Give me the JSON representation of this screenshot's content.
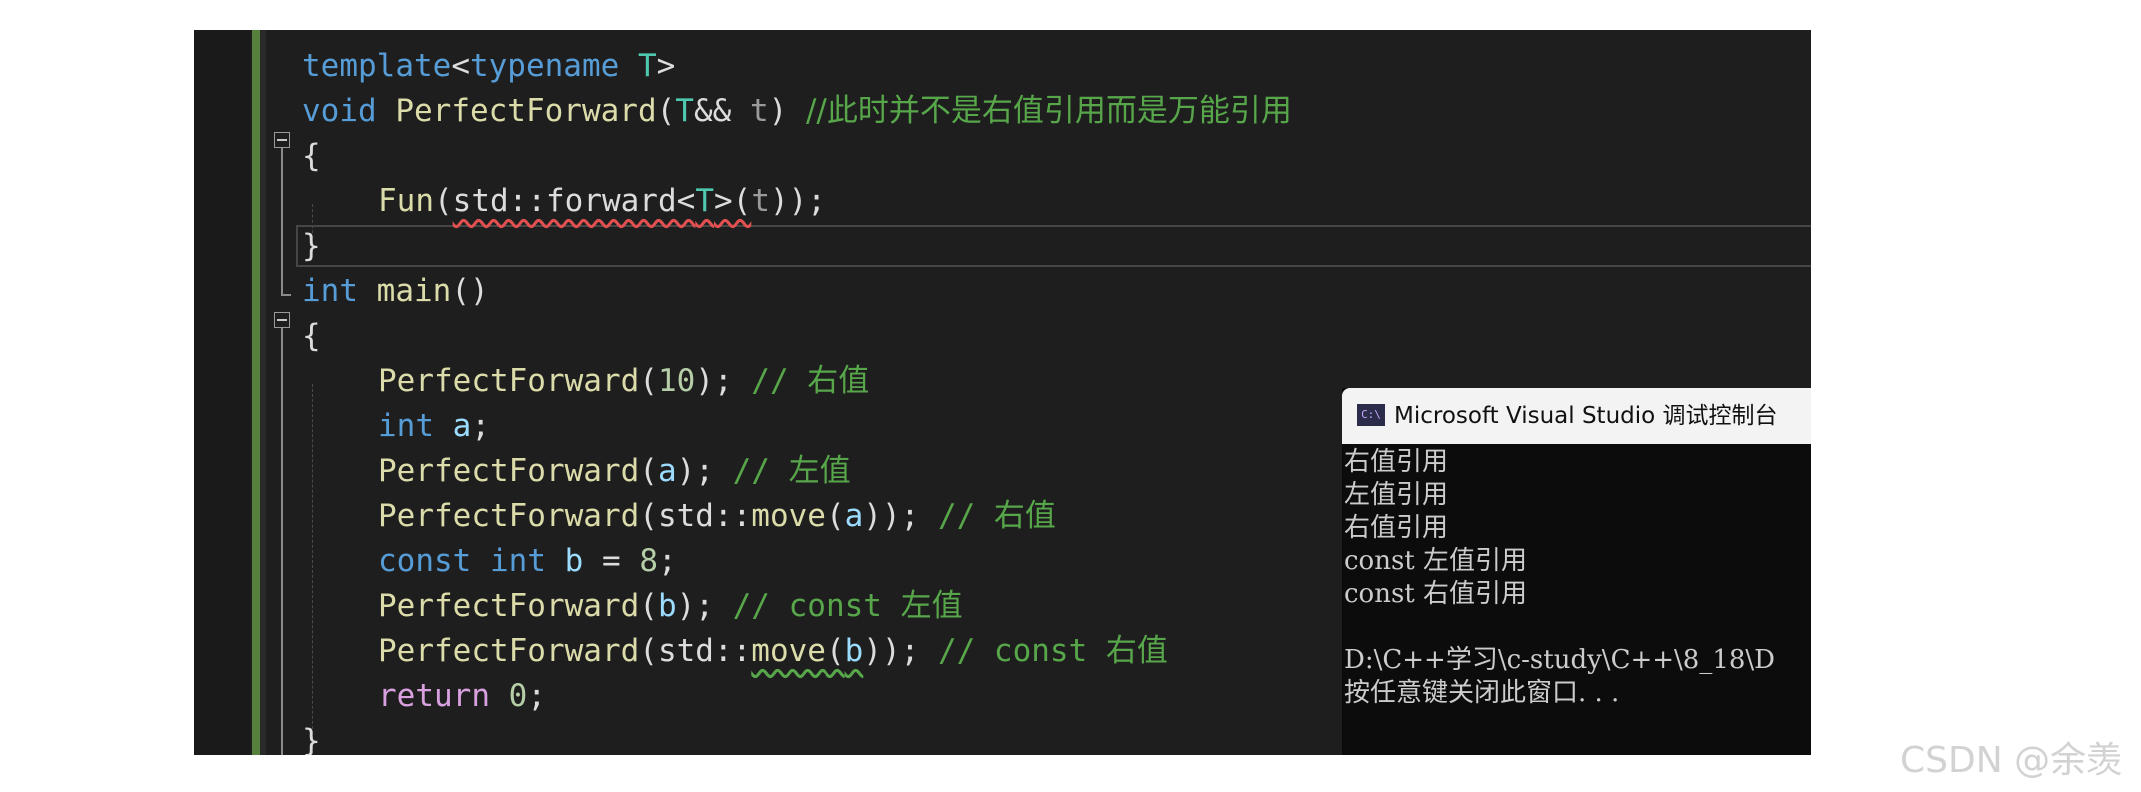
{
  "editor": {
    "lines": {
      "l1": {
        "t1": "template",
        "t2": "<",
        "t3": "typename",
        "t4": " ",
        "t5": "T",
        "t6": ">"
      },
      "l2": {
        "t1": "void",
        "t2": " ",
        "t3": "PerfectForward",
        "t4": "(",
        "t5": "T",
        "t6": "&& ",
        "t7": "t",
        "t8": ") ",
        "t9": "//此时并不是右值引用而是万能引用"
      },
      "l3": {
        "t1": "{"
      },
      "l4": {
        "t1": "Fun",
        "t2": "(",
        "t3": "std::forward<",
        "t4": "T",
        "t5": ">(",
        "t6": "t",
        "t7": "));"
      },
      "l5": {
        "t1": "}"
      },
      "l6": {
        "t1": "int",
        "t2": " ",
        "t3": "main",
        "t4": "()"
      },
      "l7": {
        "t1": "{"
      },
      "l8": {
        "t1": "PerfectForward",
        "t2": "(",
        "t3": "10",
        "t4": "); ",
        "t5": "// 右值"
      },
      "l9": {
        "t1": "int",
        "t2": " ",
        "t3": "a",
        "t4": ";"
      },
      "l10": {
        "t1": "PerfectForward",
        "t2": "(",
        "t3": "a",
        "t4": "); ",
        "t5": "// 左值"
      },
      "l11": {
        "t1": "PerfectForward",
        "t2": "(std::",
        "t3": "move",
        "t4": "(",
        "t5": "a",
        "t6": ")); ",
        "t7": "// 右值"
      },
      "l12": {
        "t1": "const",
        "t2": " ",
        "t3": "int",
        "t4": " ",
        "t5": "b",
        "t6": " = ",
        "t7": "8",
        "t8": ";"
      },
      "l13": {
        "t1": "PerfectForward",
        "t2": "(",
        "t3": "b",
        "t4": "); ",
        "t5": "// const 左值"
      },
      "l14": {
        "t1": "PerfectForward",
        "t2": "(std::",
        "t3": "move",
        "t4": "(",
        "t5": "b",
        "t6": ")); ",
        "t7": "// const 右值"
      },
      "l15": {
        "t1": "return",
        "t2": " ",
        "t3": "0",
        "t4": ";"
      },
      "l16": {
        "t1": "}"
      }
    }
  },
  "console": {
    "title": "Microsoft Visual Studio 调试控制台",
    "icon_label": "C:\\",
    "icon": "vs-console-icon",
    "lines": {
      "o1": "右值引用",
      "o2": "左值引用",
      "o3": "右值引用",
      "o4": "const 左值引用",
      "o5": "const 右值引用",
      "o6": "",
      "o7": "D:\\C++学习\\c-study\\C++\\8_18\\D",
      "o8": "按任意键关闭此窗口. . ."
    }
  },
  "watermark": "CSDN @余羡",
  "colors": {
    "keyword": "#569cd6",
    "type": "#4ec9b0",
    "function": "#dcdcaa",
    "comment": "#57a64a",
    "number": "#b5cea8",
    "variable": "#9cdcfe",
    "control": "#d8a0df",
    "editor_bg": "#1e1e1e",
    "console_bg": "#0c0c0c"
  }
}
